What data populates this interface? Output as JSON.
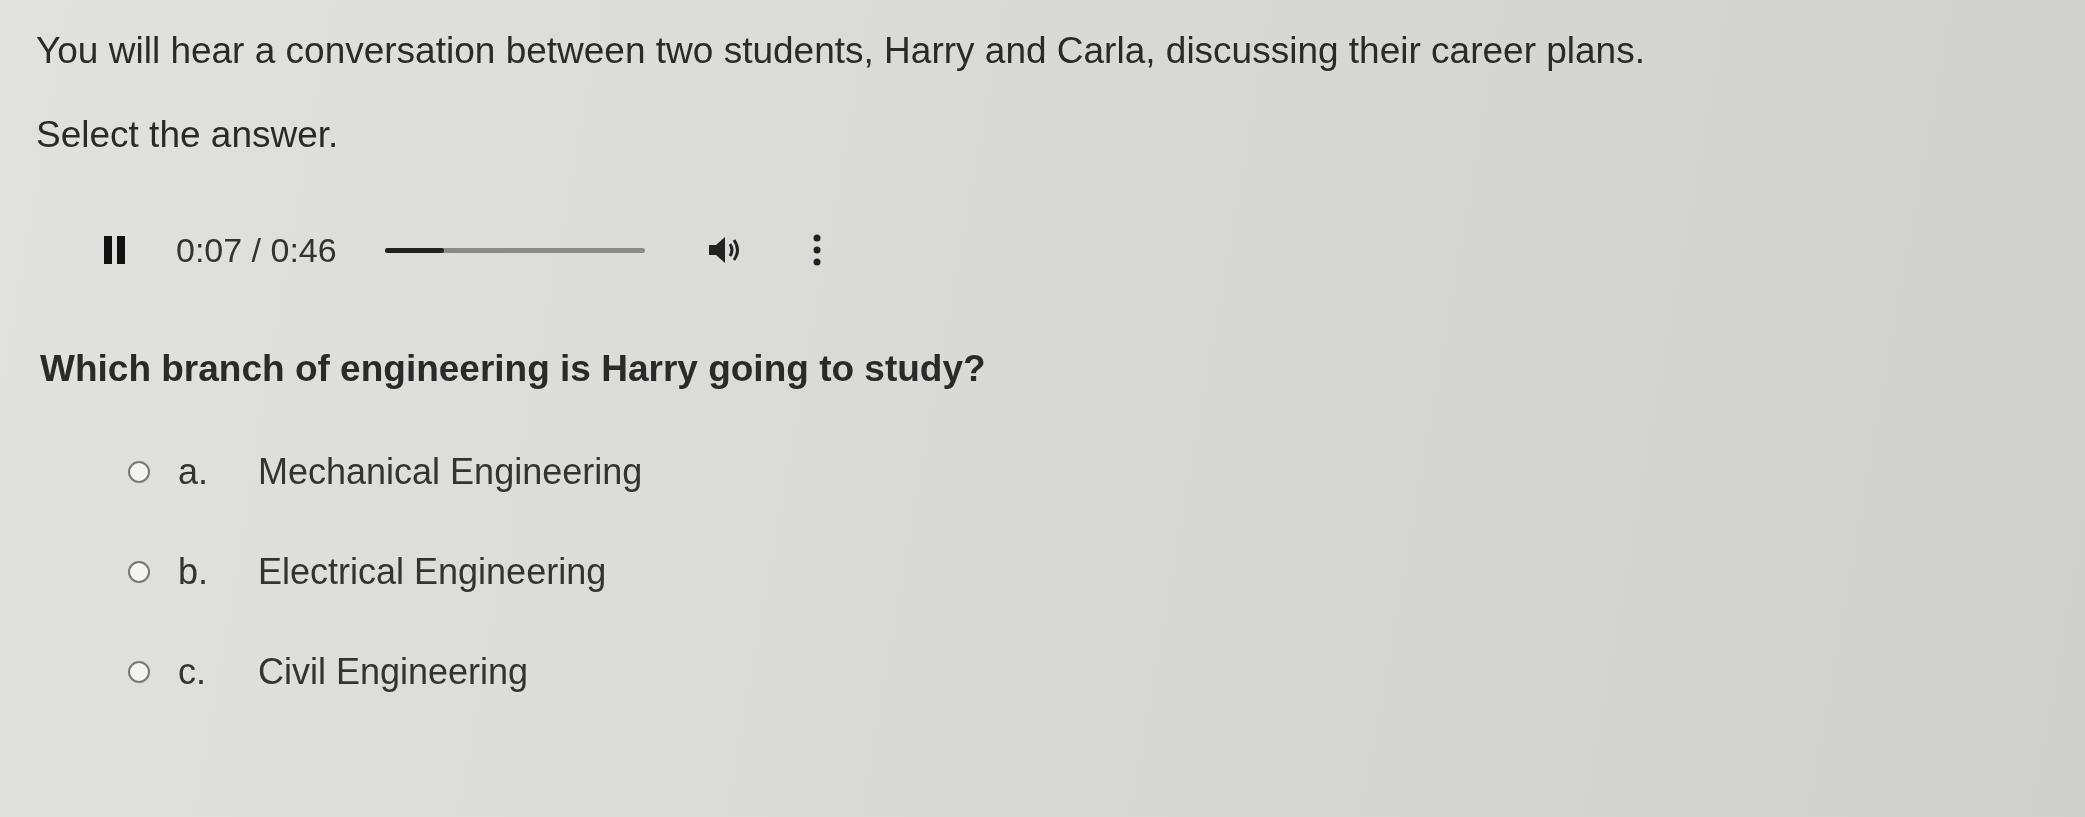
{
  "instructions": [
    "You will hear a conversation between two students, Harry and Carla, discussing their career plans.",
    "Select the answer."
  ],
  "player": {
    "playing": true,
    "time": "0:07 / 0:46",
    "level": 0.23
  },
  "question": "Which branch of engineering is Harry going to study?",
  "options": [
    {
      "letter": "a.",
      "label": "Mechanical Engineering",
      "selected": false
    },
    {
      "letter": "b.",
      "label": "Electrical Engineering",
      "selected": false
    },
    {
      "letter": "c.",
      "label": "Civil Engineering",
      "selected": false
    }
  ]
}
